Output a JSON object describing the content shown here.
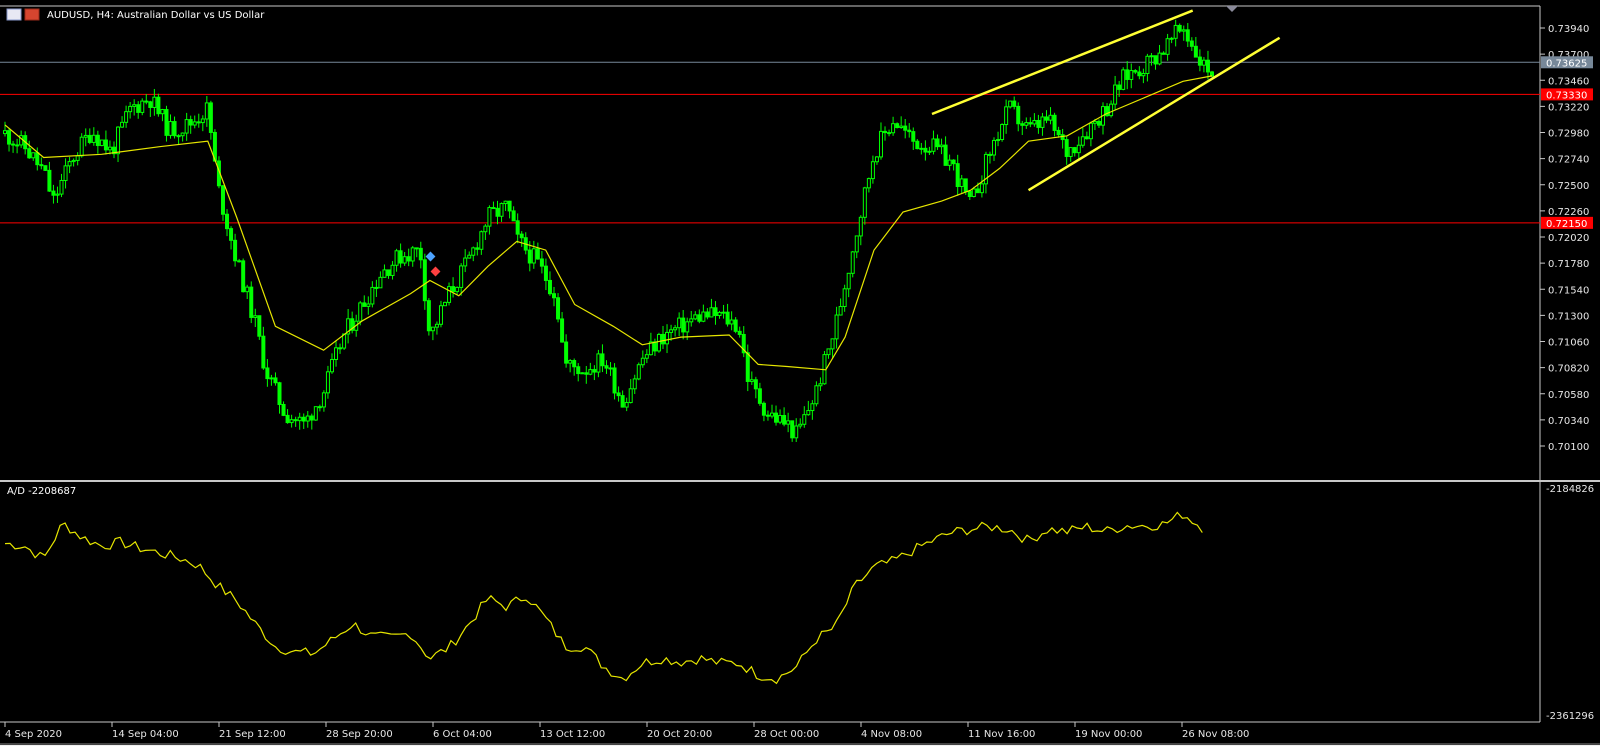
{
  "header": {
    "symbol": "AUDUSD",
    "timeframe": "H4",
    "title": "AUDUSD, H4:  Australian Dollar vs US Dollar"
  },
  "colors": {
    "background": "#000000",
    "candle": "#00ff00",
    "moving_average": "#e6e600",
    "trendline": "#ffff33",
    "level_line": "#ff0000",
    "ask_line": "#778899",
    "indicator_line": "#e6e600",
    "axis_text": "#e6e6e6"
  },
  "price_axis": {
    "ticks": [
      "0.73940",
      "0.73700",
      "0.73460",
      "0.73220",
      "0.72980",
      "0.72740",
      "0.72500",
      "0.72260",
      "0.72020",
      "0.71780",
      "0.71540",
      "0.71300",
      "0.71060",
      "0.70820",
      "0.70580",
      "0.70340",
      "0.70100"
    ],
    "current_price_tag": "0.73625",
    "level_tags": [
      "0.73330",
      "0.72150"
    ]
  },
  "time_axis": {
    "labels": [
      "4 Sep 2020",
      "14 Sep 04:00",
      "21 Sep 12:00",
      "28 Sep 20:00",
      "6 Oct 04:00",
      "13 Oct 12:00",
      "20 Oct 20:00",
      "28 Oct 00:00",
      "4 Nov 08:00",
      "11 Nov 16:00",
      "19 Nov 00:00",
      "26 Nov 08:00"
    ]
  },
  "indicator": {
    "label": "A/D -2208687",
    "max_label": "-2184826",
    "min_label": "-2361296"
  },
  "chart_data": [
    {
      "type": "candlestick",
      "title": "AUDUSD, H4:  Australian Dollar vs US Dollar",
      "ylim": [
        0.6996,
        0.7414
      ],
      "current_price": 0.73625,
      "horizontal_levels": [
        0.7333,
        0.7215
      ],
      "x_ticks": [
        "4 Sep 2020",
        "14 Sep 04:00",
        "21 Sep 12:00",
        "28 Sep 20:00",
        "6 Oct 04:00",
        "13 Oct 12:00",
        "20 Oct 20:00",
        "28 Oct 00:00",
        "4 Nov 08:00",
        "11 Nov 16:00",
        "19 Nov 00:00",
        "26 Nov 08:00"
      ],
      "close_path": [
        {
          "x": 0,
          "y": 0.7297
        },
        {
          "x": 2,
          "y": 0.7285
        },
        {
          "x": 4,
          "y": 0.7262
        },
        {
          "x": 5,
          "y": 0.7235
        },
        {
          "x": 7,
          "y": 0.7275
        },
        {
          "x": 9,
          "y": 0.73
        },
        {
          "x": 11,
          "y": 0.728
        },
        {
          "x": 13,
          "y": 0.732
        },
        {
          "x": 15,
          "y": 0.733
        },
        {
          "x": 17,
          "y": 0.73
        },
        {
          "x": 19,
          "y": 0.7305
        },
        {
          "x": 21,
          "y": 0.732
        },
        {
          "x": 22,
          "y": 0.725
        },
        {
          "x": 24,
          "y": 0.718
        },
        {
          "x": 26,
          "y": 0.712
        },
        {
          "x": 27,
          "y": 0.708
        },
        {
          "x": 29,
          "y": 0.704
        },
        {
          "x": 31,
          "y": 0.703
        },
        {
          "x": 33,
          "y": 0.706
        },
        {
          "x": 35,
          "y": 0.711
        },
        {
          "x": 37,
          "y": 0.714
        },
        {
          "x": 39,
          "y": 0.717
        },
        {
          "x": 41,
          "y": 0.7185
        },
        {
          "x": 43,
          "y": 0.719
        },
        {
          "x": 44,
          "y": 0.711
        },
        {
          "x": 46,
          "y": 0.715
        },
        {
          "x": 48,
          "y": 0.718
        },
        {
          "x": 50,
          "y": 0.722
        },
        {
          "x": 52,
          "y": 0.723
        },
        {
          "x": 53,
          "y": 0.72
        },
        {
          "x": 55,
          "y": 0.718
        },
        {
          "x": 57,
          "y": 0.715
        },
        {
          "x": 58,
          "y": 0.7085
        },
        {
          "x": 60,
          "y": 0.708
        },
        {
          "x": 62,
          "y": 0.709
        },
        {
          "x": 64,
          "y": 0.705
        },
        {
          "x": 66,
          "y": 0.709
        },
        {
          "x": 68,
          "y": 0.711
        },
        {
          "x": 70,
          "y": 0.712
        },
        {
          "x": 72,
          "y": 0.713
        },
        {
          "x": 74,
          "y": 0.713
        },
        {
          "x": 76,
          "y": 0.712
        },
        {
          "x": 77,
          "y": 0.707
        },
        {
          "x": 79,
          "y": 0.704
        },
        {
          "x": 81,
          "y": 0.703
        },
        {
          "x": 82,
          "y": 0.702
        },
        {
          "x": 84,
          "y": 0.706
        },
        {
          "x": 86,
          "y": 0.712
        },
        {
          "x": 88,
          "y": 0.72
        },
        {
          "x": 90,
          "y": 0.728
        },
        {
          "x": 92,
          "y": 0.731
        },
        {
          "x": 94,
          "y": 0.729
        },
        {
          "x": 96,
          "y": 0.7285
        },
        {
          "x": 98,
          "y": 0.727
        },
        {
          "x": 100,
          "y": 0.723
        },
        {
          "x": 102,
          "y": 0.728
        },
        {
          "x": 104,
          "y": 0.732
        },
        {
          "x": 106,
          "y": 0.73
        },
        {
          "x": 108,
          "y": 0.731
        },
        {
          "x": 110,
          "y": 0.728
        },
        {
          "x": 112,
          "y": 0.73
        },
        {
          "x": 114,
          "y": 0.732
        },
        {
          "x": 116,
          "y": 0.735
        },
        {
          "x": 118,
          "y": 0.736
        },
        {
          "x": 120,
          "y": 0.7375
        },
        {
          "x": 122,
          "y": 0.7395
        },
        {
          "x": 124,
          "y": 0.736
        },
        {
          "x": 125,
          "y": 0.7355
        }
      ],
      "moving_average": [
        {
          "x": 0,
          "y": 0.7305
        },
        {
          "x": 4,
          "y": 0.7275
        },
        {
          "x": 10,
          "y": 0.7278
        },
        {
          "x": 16,
          "y": 0.7285
        },
        {
          "x": 21,
          "y": 0.729
        },
        {
          "x": 24,
          "y": 0.722
        },
        {
          "x": 28,
          "y": 0.712
        },
        {
          "x": 33,
          "y": 0.7098
        },
        {
          "x": 37,
          "y": 0.7125
        },
        {
          "x": 42,
          "y": 0.715
        },
        {
          "x": 44,
          "y": 0.7162
        },
        {
          "x": 47,
          "y": 0.7148
        },
        {
          "x": 50,
          "y": 0.7175
        },
        {
          "x": 53,
          "y": 0.7198
        },
        {
          "x": 56,
          "y": 0.719
        },
        {
          "x": 59,
          "y": 0.714
        },
        {
          "x": 63,
          "y": 0.712
        },
        {
          "x": 66,
          "y": 0.7103
        },
        {
          "x": 70,
          "y": 0.711
        },
        {
          "x": 75,
          "y": 0.7112
        },
        {
          "x": 78,
          "y": 0.7085
        },
        {
          "x": 81,
          "y": 0.7083
        },
        {
          "x": 85,
          "y": 0.708
        },
        {
          "x": 87,
          "y": 0.711
        },
        {
          "x": 90,
          "y": 0.719
        },
        {
          "x": 93,
          "y": 0.7225
        },
        {
          "x": 97,
          "y": 0.7235
        },
        {
          "x": 100,
          "y": 0.7245
        },
        {
          "x": 103,
          "y": 0.7265
        },
        {
          "x": 106,
          "y": 0.729
        },
        {
          "x": 110,
          "y": 0.7295
        },
        {
          "x": 114,
          "y": 0.7315
        },
        {
          "x": 118,
          "y": 0.733
        },
        {
          "x": 122,
          "y": 0.7345
        },
        {
          "x": 125,
          "y": 0.735
        }
      ],
      "trendlines": [
        {
          "x1": 96,
          "y1": 0.7315,
          "x2": 123,
          "y2": 0.741
        },
        {
          "x1": 106,
          "y1": 0.7245,
          "x2": 132,
          "y2": 0.7385
        }
      ]
    },
    {
      "type": "line",
      "title": "A/D -2208687",
      "ylim": [
        -2361296,
        -2184826
      ],
      "series": [
        {
          "values": [
            {
              "x": 0,
              "y": -2222000
            },
            {
              "x": 2,
              "y": -2224000
            },
            {
              "x": 4,
              "y": -2235000
            },
            {
              "x": 6,
              "y": -2205000
            },
            {
              "x": 8,
              "y": -2217000
            },
            {
              "x": 10,
              "y": -2224000
            },
            {
              "x": 12,
              "y": -2221000
            },
            {
              "x": 14,
              "y": -2226000
            },
            {
              "x": 16,
              "y": -2230000
            },
            {
              "x": 18,
              "y": -2234000
            },
            {
              "x": 20,
              "y": -2240000
            },
            {
              "x": 22,
              "y": -2257000
            },
            {
              "x": 24,
              "y": -2270000
            },
            {
              "x": 26,
              "y": -2290000
            },
            {
              "x": 28,
              "y": -2308000
            },
            {
              "x": 30,
              "y": -2313000
            },
            {
              "x": 32,
              "y": -2314000
            },
            {
              "x": 34,
              "y": -2302000
            },
            {
              "x": 36,
              "y": -2289000
            },
            {
              "x": 38,
              "y": -2300000
            },
            {
              "x": 40,
              "y": -2301000
            },
            {
              "x": 42,
              "y": -2297000
            },
            {
              "x": 44,
              "y": -2318000
            },
            {
              "x": 46,
              "y": -2309000
            },
            {
              "x": 48,
              "y": -2290000
            },
            {
              "x": 50,
              "y": -2268000
            },
            {
              "x": 52,
              "y": -2275000
            },
            {
              "x": 54,
              "y": -2265000
            },
            {
              "x": 56,
              "y": -2285000
            },
            {
              "x": 58,
              "y": -2308000
            },
            {
              "x": 60,
              "y": -2308000
            },
            {
              "x": 62,
              "y": -2325000
            },
            {
              "x": 64,
              "y": -2335000
            },
            {
              "x": 66,
              "y": -2322000
            },
            {
              "x": 68,
              "y": -2318000
            },
            {
              "x": 70,
              "y": -2321000
            },
            {
              "x": 72,
              "y": -2318000
            },
            {
              "x": 74,
              "y": -2322000
            },
            {
              "x": 76,
              "y": -2322000
            },
            {
              "x": 78,
              "y": -2332000
            },
            {
              "x": 80,
              "y": -2335000
            },
            {
              "x": 82,
              "y": -2325000
            },
            {
              "x": 84,
              "y": -2302000
            },
            {
              "x": 86,
              "y": -2292000
            },
            {
              "x": 88,
              "y": -2258000
            },
            {
              "x": 90,
              "y": -2242000
            },
            {
              "x": 92,
              "y": -2237000
            },
            {
              "x": 94,
              "y": -2228000
            },
            {
              "x": 96,
              "y": -2220000
            },
            {
              "x": 98,
              "y": -2213000
            },
            {
              "x": 100,
              "y": -2210000
            },
            {
              "x": 102,
              "y": -2208000
            },
            {
              "x": 104,
              "y": -2210000
            },
            {
              "x": 106,
              "y": -2220000
            },
            {
              "x": 108,
              "y": -2210000
            },
            {
              "x": 110,
              "y": -2212000
            },
            {
              "x": 112,
              "y": -2208000
            },
            {
              "x": 114,
              "y": -2212000
            },
            {
              "x": 116,
              "y": -2207000
            },
            {
              "x": 118,
              "y": -2207000
            },
            {
              "x": 120,
              "y": -2206000
            },
            {
              "x": 122,
              "y": -2197000
            },
            {
              "x": 124,
              "y": -2208687
            }
          ]
        }
      ]
    }
  ]
}
